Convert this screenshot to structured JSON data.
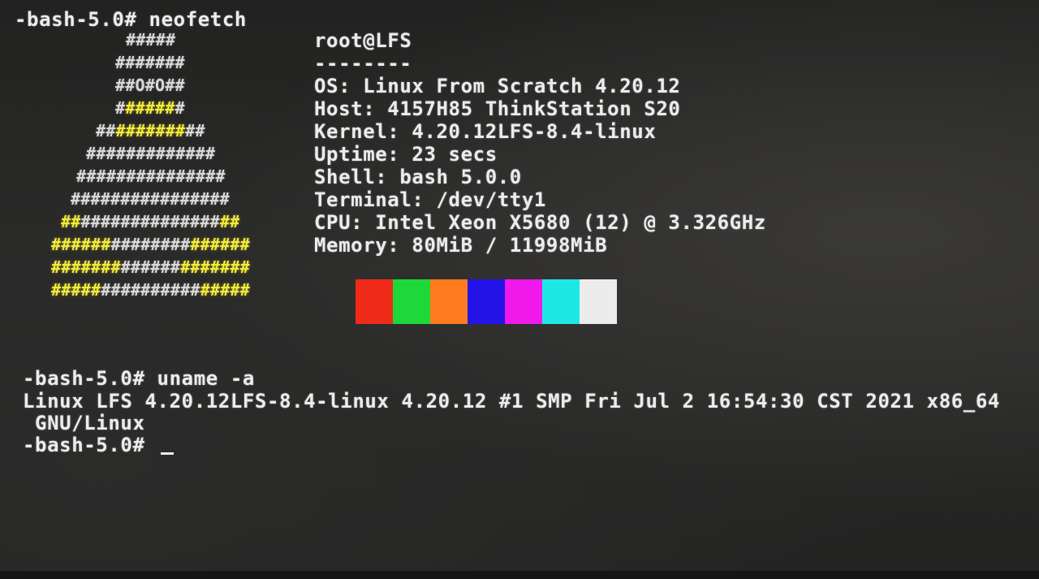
{
  "prompt1": "-bash-5.0# neofetch",
  "logo": [
    {
      "segs": [
        {
          "t": "#####",
          "c": "w"
        }
      ]
    },
    {
      "segs": [
        {
          "t": "#######",
          "c": "w"
        }
      ]
    },
    {
      "segs": [
        {
          "t": "##O#O##",
          "c": "w"
        }
      ]
    },
    {
      "segs": [
        {
          "t": "#",
          "c": "w"
        },
        {
          "t": "#####",
          "c": "y"
        },
        {
          "t": "#",
          "c": "w"
        }
      ]
    },
    {
      "segs": [
        {
          "t": "##",
          "c": "w"
        },
        {
          "t": "#######",
          "c": "y"
        },
        {
          "t": "##",
          "c": "w"
        }
      ]
    },
    {
      "segs": [
        {
          "t": "#############",
          "c": "w"
        }
      ]
    },
    {
      "segs": [
        {
          "t": "###############",
          "c": "w"
        }
      ]
    },
    {
      "segs": [
        {
          "t": "################",
          "c": "w"
        }
      ]
    },
    {
      "segs": [
        {
          "t": "##",
          "c": "y"
        },
        {
          "t": "##############",
          "c": "w"
        },
        {
          "t": "##",
          "c": "y"
        }
      ]
    },
    {
      "segs": [
        {
          "t": "######",
          "c": "y"
        },
        {
          "t": "########",
          "c": "w"
        },
        {
          "t": "######",
          "c": "y"
        }
      ]
    },
    {
      "segs": [
        {
          "t": "#######",
          "c": "y"
        },
        {
          "t": "######",
          "c": "w"
        },
        {
          "t": "#######",
          "c": "y"
        }
      ]
    },
    {
      "segs": [
        {
          "t": "#####",
          "c": "y"
        },
        {
          "t": "##########",
          "c": "w"
        },
        {
          "t": "#####",
          "c": "y"
        }
      ]
    }
  ],
  "info": {
    "user_host": "root@LFS",
    "separator": "--------",
    "os": "OS: Linux From Scratch 4.20.12",
    "host": "Host: 4157H85 ThinkStation S20",
    "kernel": "Kernel: 4.20.12LFS-8.4-linux",
    "uptime": "Uptime: 23 secs",
    "shell": "Shell: bash 5.0.0",
    "terminal": "Terminal: /dev/tty1",
    "cpu": "CPU: Intel Xeon X5680 (12) @ 3.326GHz",
    "memory": "Memory: 80MiB / 11998MiB"
  },
  "palette": [
    "#f02a18",
    "#1ed83a",
    "#ff7c1e",
    "#2414e8",
    "#f018ea",
    "#1ee8e4",
    "#ececec"
  ],
  "prompt2": "-bash-5.0# uname -a",
  "uname_output_1": "Linux LFS 4.20.12LFS-8.4-linux 4.20.12 #1 SMP Fri Jul 2 16:54:30 CST 2021 x86_64",
  "uname_output_2": " GNU/Linux",
  "prompt3": "-bash-5.0# "
}
